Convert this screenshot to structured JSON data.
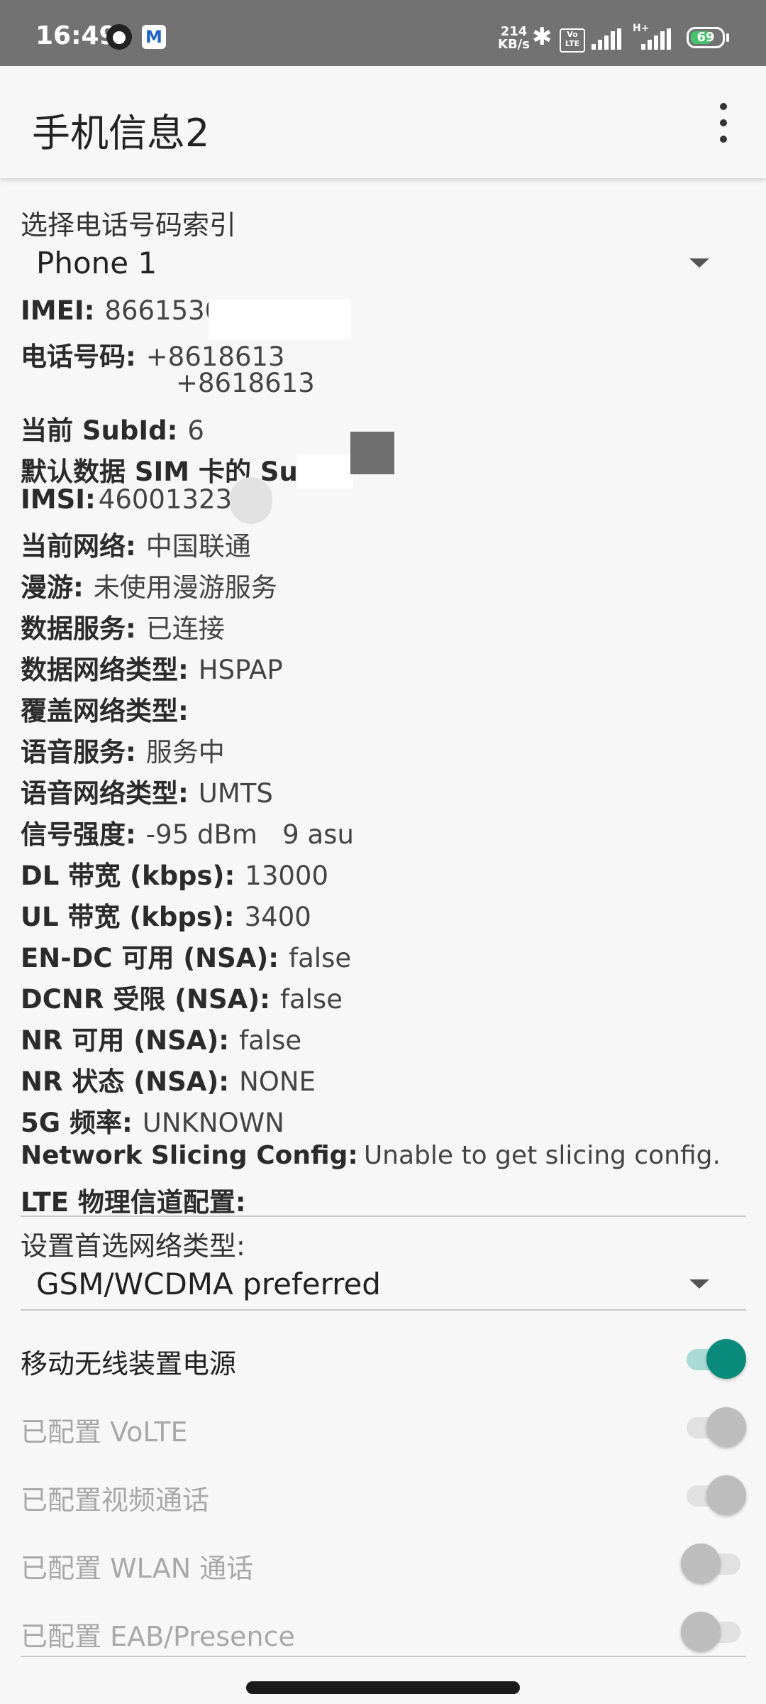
{
  "statusbar": {
    "time": "16:49",
    "speed_value": "214",
    "speed_unit": "KB/s",
    "volte_top": "Vo",
    "volte_bottom": "LTE",
    "network_type": "H+",
    "battery": "69",
    "battery_color": "#46c36c"
  },
  "appbar": {
    "title": "手机信息2",
    "menu_icon": "overflow-menu-icon"
  },
  "phone_index": {
    "label": "选择电话号码索引",
    "selected": "Phone 1"
  },
  "info": {
    "imei": {
      "key": "IMEI:",
      "value": "866153065"
    },
    "phone_number": {
      "key": "电话号码:",
      "value1": "+8618613",
      "value2": "+8618613"
    },
    "sub_id": {
      "key": "当前 SubId:",
      "value": "6"
    },
    "default_data_sim": {
      "key": "默认数据 SIM 卡的 Su",
      "value": ""
    },
    "imsi": {
      "key": "IMSI:",
      "value": "46001323"
    },
    "current_network": {
      "key": "当前网络:",
      "value": "中国联通"
    },
    "roaming": {
      "key": "漫游:",
      "value": "未使用漫游服务"
    },
    "data_service": {
      "key": "数据服务:",
      "value": "已连接"
    },
    "data_network_type": {
      "key": "数据网络类型:",
      "value": "HSPAP"
    },
    "override_network_type": {
      "key": "覆盖网络类型:",
      "value": ""
    },
    "voice_service": {
      "key": "语音服务:",
      "value": "服务中"
    },
    "voice_network_type": {
      "key": "语音网络类型:",
      "value": "UMTS"
    },
    "signal_strength": {
      "key": "信号强度:",
      "value": "-95 dBm   9 asu"
    },
    "dl_bandwidth": {
      "key": "DL 带宽 (kbps):",
      "value": "13000"
    },
    "ul_bandwidth": {
      "key": "UL 带宽 (kbps):",
      "value": "3400"
    },
    "endc_available": {
      "key": "EN-DC 可用 (NSA):",
      "value": "false"
    },
    "dcnr_restricted": {
      "key": "DCNR 受限 (NSA):",
      "value": "false"
    },
    "nr_available": {
      "key": "NR 可用 (NSA):",
      "value": "false"
    },
    "nr_state": {
      "key": "NR 状态 (NSA):",
      "value": "NONE"
    },
    "freq_5g": {
      "key": "5G 频率:",
      "value": "UNKNOWN"
    },
    "network_slicing": {
      "key": "Network Slicing Config:",
      "value": "Unable to get slicing config."
    },
    "lte_physical_channel": {
      "key": "LTE 物理信道配置:",
      "value": ""
    }
  },
  "preferred_network": {
    "label": "设置首选网络类型:",
    "selected": "GSM/WCDMA preferred"
  },
  "switches": [
    {
      "label": "移动无线装置电源",
      "on": true,
      "enabled": true
    },
    {
      "label": "已配置 VoLTE",
      "on": true,
      "enabled": false
    },
    {
      "label": "已配置视频通话",
      "on": true,
      "enabled": false
    },
    {
      "label": "已配置 WLAN 通话",
      "on": false,
      "enabled": false
    },
    {
      "label": "已配置 EAB/Presence",
      "on": false,
      "enabled": false
    }
  ],
  "colors": {
    "accent": "#0a8a7a",
    "accent_track": "#a9dbd4",
    "disabled_text": "#a8a8a8",
    "disabled_thumb": "#bdbdbd",
    "disabled_track": "#e1e1e1"
  }
}
